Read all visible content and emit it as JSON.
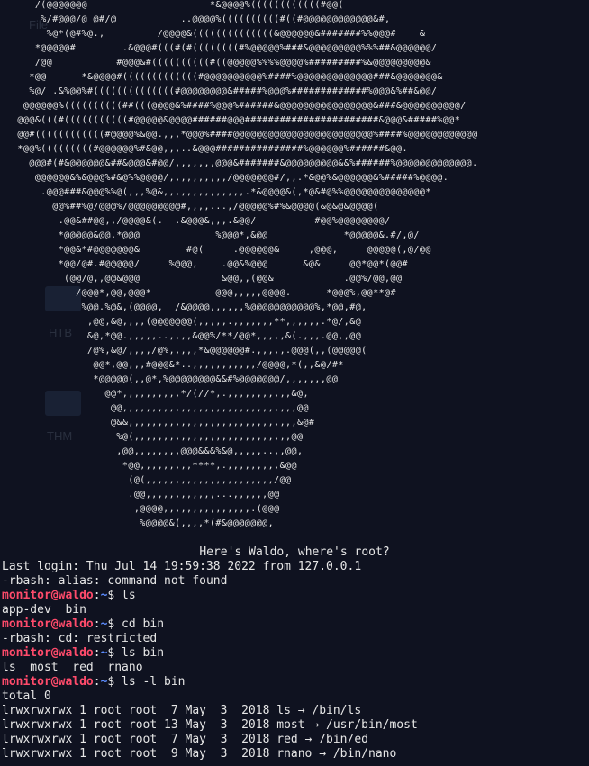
{
  "desktop": {
    "icons": [
      {
        "label": "File"
      },
      {
        "label": "HTB"
      },
      {
        "label": "THM"
      }
    ]
  },
  "banner": {
    "ascii_lines": [
      "      /(@@@@@@@                     *&@@@@%((((((((((((#@@(",
      "       %/#@@@/@ @#/@           ..@@@@%((((((((((#((#@@@@@@@@@@@@&#,",
      "        %@*(@#%@.,         /@@@@&((((((((((((((&@@@@@@&#######%%@@@#    &",
      "      *@@@@@#        .&@@@#(((#(#((((((((#%@@@@@%###&@@@@@@@@@%%%##&@@@@@@/",
      "      /@@           #@@@&#((((((((((#((@@@@@%%%%@@@@%#########%&@@@@@@@@@&",
      "     *@@      *&@@@@#(((((((((((((#@@@@@@@@@@%####%@@@@@@@@@@@@@###&@@@@@@@&",
      "     %@/ .&%@@%#((((((((((((((#@@@@@@@@&#####%@@@%#############%@@@&%##&@@/",
      "    @@@@@@%((((((((((##(((@@@@&%####%@@@%######&@@@@@@@@@@@@@@@@&###&@@@@@@@@@@/",
      "   @@@&(((#(((((((((((#@@@@@&@@@@######@@@#######################&@@@&#####%@@*",
      "   @@#((((((((((((#@@@@%&@@.,,,*@@@%####@@@@@@@@@@@@@@@@@@@@@@@@%####%@@@@@@@@@@@@",
      "   *@@%(((((((((#@@@@@@%#&@@,,,..&@@@###############%@@@@@@%######&@@.",
      "     @@@#(#&@@@@@@&##&@@@&#@@/,,,,,,,@@@&#######&@@@@@@@@@&&%######%@@@@@@@@@@@@@.",
      "      @@@@@@&%&@@@%#&@%%@@@@/,,,,,,,,,,/@@@@@@@#/,,.*&@@%&@@@@@@&%#####%@@@@.",
      "       .@@@###&@@@%%@(,,,%@&,,,,,,,,,,,,,,.*&@@@@&(,*@&#@%%@@@@@@@@@@@@@@*",
      "         @@%##%@/@@@%/@@@@@@@@@#,,,,...,/@@@@@%#%&@@@@(&@&@&@@@@(",
      "          .@@&##@@,,/@@@@&(.  .&@@@&,,,.&@@/          #@@%@@@@@@@@/",
      "          *@@@@@&@@.*@@@             %@@@*,&@@             *@@@@@&.#/,@/",
      "          *@@&*#@@@@@@@&        #@(     .@@@@@@&     ,@@@,     @@@@@(,@/@@",
      "          *@@/@#.#@@@@@/     %@@@,    .@@&%@@@      &@&     @@*@@*(@@#",
      "           (@@/@,,@@&@@@              &@@,,(@@&            .@@%/@@,@@",
      "             /@@@*,@@,@@@*           @@@,,,,,@@@@.      *@@@%,@@**@#",
      "              %@@.%@&,(@@@@,  /&@@@@,,,,,,%@@@@@@@@@@@%,*@@,#@,",
      "               ,@@,&@,,,,(@@@@@@@(,,,,,.,,,,,,,**,,,,,,.*@/,&@",
      "               &@,*@@.,,,,,..,,,,&@@%/**/@@*,,,,,&(.,,,.@@,,@@",
      "               /@%,&@/,,,,/@%,,,,,*&@@@@@@#.,,,,,.@@@(,,(@@@@@(",
      "                @@*,@@,,,#@@@&*..,,,,,,,,,,,/@@@@,*(,,&@/#*",
      "                *@@@@@(,,@*,%@@@@@@@@&&#%@@@@@@@/,,,,,,,@@",
      "                  @@*,,,,,,,,,,*/(//*,.,,,,,,,,,,,&@,",
      "                   @@,,,,,,,,,,,,,,,,,,,,,,,,,,,,,,@@",
      "                   @&&,,,,,,,,,,,,,,,,,,,,,,,,,,,,,&@#",
      "                    %@(,,,,,,,,,,,,,,,,,,,,,,,,,,,@@",
      "                    ,@@,,,,,,,,@@@&&&%&@,,,,,..,,@@,",
      "                     *@@,,,,,,,,,****,.,,,,,,,,,&@@",
      "                      (@(,,,,,,,,,,,,,,,,,,,,,,/@@",
      "                      .@@,,,,,,,,,,,,...,,,,,,@@",
      "                       ,@@@@,,,,,,,,,,,,,,,.(@@@",
      "                        %@@@@&(,,,,*(#&@@@@@@@,"
    ]
  },
  "session": {
    "motd": "Here's Waldo, where's root?",
    "last_login": "Last login: Thu Jul 14 19:59:38 2022 from 127.0.0.1",
    "alias_error": "-rbash: alias: command not found",
    "prompt_user": "monitor@waldo",
    "prompt_sep": ":",
    "prompt_path": "~",
    "prompt_symbol": "$",
    "commands": [
      {
        "cmd": " ls",
        "output": [
          "app-dev  bin"
        ]
      },
      {
        "cmd": " cd bin",
        "output": [
          "-rbash: cd: restricted"
        ]
      },
      {
        "cmd": " ls bin",
        "output": [
          "ls  most  red  rnano"
        ]
      },
      {
        "cmd": " ls -l bin",
        "output": [
          "total 0",
          "lrwxrwxrwx 1 root root  7 May  3  2018 ls → /bin/ls",
          "lrwxrwxrwx 1 root root 13 May  3  2018 most → /usr/bin/most",
          "lrwxrwxrwx 1 root root  7 May  3  2018 red → /bin/ed",
          "lrwxrwxrwx 1 root root  9 May  3  2018 rnano → /bin/nano"
        ]
      }
    ]
  },
  "colors": {
    "background": "#0f1220",
    "user": "#ff4b6b",
    "path": "#5c8cff",
    "text": "#e6e6e6"
  }
}
